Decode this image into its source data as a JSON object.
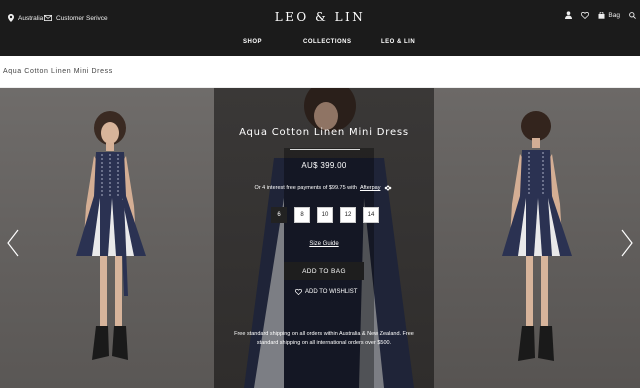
{
  "header": {
    "location": "Australia",
    "customer_service": "Customer Serivce",
    "logo": "LEO & LIN",
    "bag_label": "Bag"
  },
  "nav": {
    "items": [
      "SHOP",
      "COLLECTIONS",
      "LEO & LIN"
    ]
  },
  "breadcrumb": "Aqua Cotton Linen Mini Dress",
  "product": {
    "title": "Aqua Cotton Linen Mini Dress",
    "price": "AU$ 399.00",
    "afterpay_text": "Or 4 interest free payments of $99.75 with",
    "afterpay_link": "Afterpay",
    "sizes": [
      "6",
      "8",
      "10",
      "12",
      "14"
    ],
    "selected_size": "6",
    "size_guide": "Size Guide",
    "add_to_bag": "ADD TO BAG",
    "add_to_wishlist": "ADD TO WISHLIST",
    "shipping_line1": "Free standard shipping on all orders within Australia & New Zealand. Free",
    "shipping_line2": "standard shipping on all international orders over $500."
  },
  "colors": {
    "header_bg": "#1b1b1b",
    "dress_navy": "#2b3252",
    "button_dark": "#1e1e1e"
  },
  "icons": [
    "location-pin-icon",
    "mail-icon",
    "user-icon",
    "heart-icon",
    "bag-icon",
    "search-icon",
    "afterpay-icon",
    "chevron-left-icon",
    "chevron-right-icon"
  ]
}
